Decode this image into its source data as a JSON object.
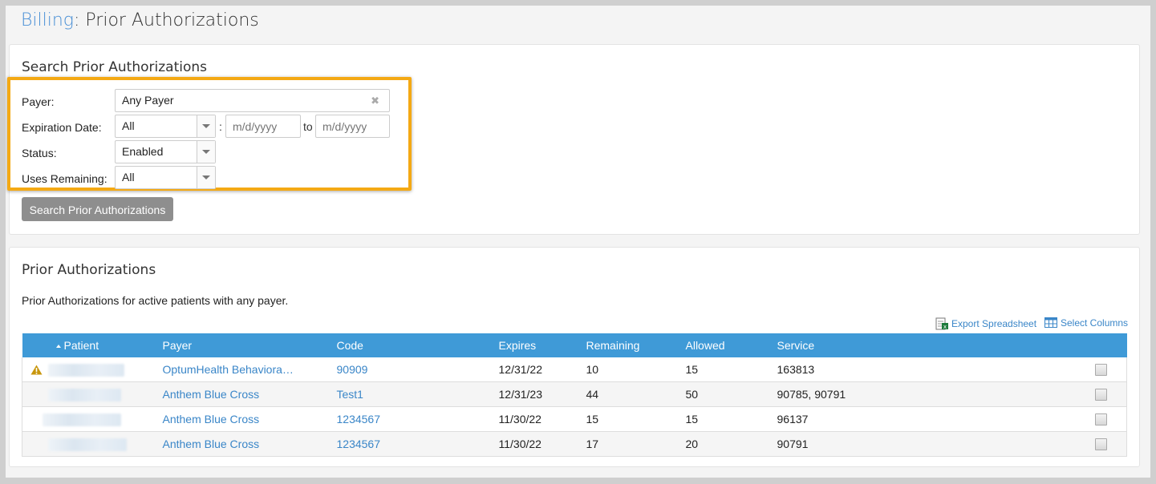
{
  "header": {
    "crumb": "Billing",
    "separator": ":",
    "title": " Prior Authorizations"
  },
  "search": {
    "title": "Search Prior Authorizations",
    "payer_label": "Payer:",
    "payer_value": "Any Payer",
    "payer_clear": "✖",
    "expiration_label": "Expiration Date:",
    "expiration_value": "All",
    "colon": ":",
    "date_from_placeholder": "m/d/yyyy",
    "to_label": "to",
    "date_to_placeholder": "m/d/yyyy",
    "status_label": "Status:",
    "status_value": "Enabled",
    "uses_label": "Uses Remaining:",
    "uses_value": "All",
    "button_label": "Search Prior Authorizations"
  },
  "list": {
    "title": "Prior Authorizations",
    "description": "Prior Authorizations for active patients with any payer.",
    "export_label": "Export Spreadsheet",
    "select_columns_label": "Select Columns",
    "columns": [
      "Patient",
      "Payer",
      "Code",
      "Expires",
      "Remaining",
      "Allowed",
      "Service"
    ],
    "rows": [
      {
        "warning": true,
        "payer": "OptumHealth Behaviora…",
        "code": "90909",
        "expires": "12/31/22",
        "remaining": "10",
        "allowed": "15",
        "service": "163813"
      },
      {
        "warning": false,
        "payer": "Anthem Blue Cross",
        "code": "Test1",
        "expires": "12/31/23",
        "remaining": "44",
        "allowed": "50",
        "service": "90785, 90791"
      },
      {
        "warning": false,
        "payer": "Anthem Blue Cross",
        "code": "1234567",
        "expires": "11/30/22",
        "remaining": "15",
        "allowed": "15",
        "service": "96137"
      },
      {
        "warning": false,
        "payer": "Anthem Blue Cross",
        "code": "1234567",
        "expires": "11/30/22",
        "remaining": "17",
        "allowed": "20",
        "service": "90791"
      }
    ]
  },
  "colors": {
    "accent": "#3f9ad7",
    "highlight": "#f4a914",
    "link": "#3a86c8",
    "warning": "#d9a400"
  },
  "icons": {
    "warning": "warning-icon",
    "export": "excel-icon",
    "columns": "grid-icon",
    "sort": "sort-ascending-icon"
  }
}
